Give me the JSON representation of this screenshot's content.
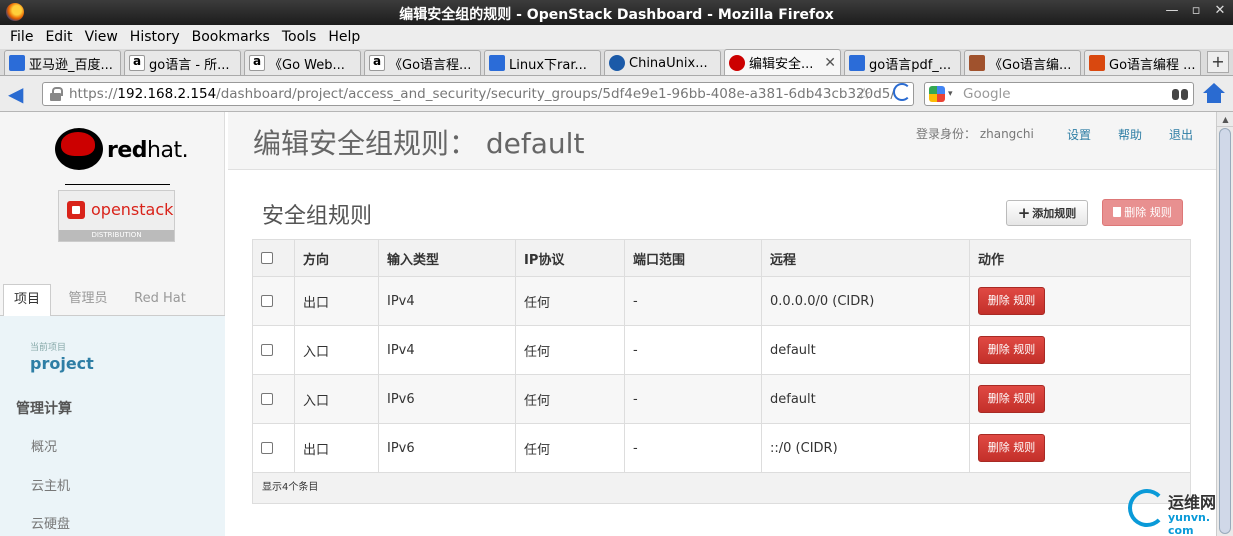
{
  "window": {
    "title": "编辑安全组的规则 - OpenStack Dashboard - Mozilla Firefox",
    "controls": [
      "—",
      "▫",
      "✕"
    ]
  },
  "menu": [
    "File",
    "Edit",
    "View",
    "History",
    "Bookmarks",
    "Tools",
    "Help"
  ],
  "tabs": [
    {
      "label": "亚马逊_百度...",
      "icon": "paw"
    },
    {
      "label": "go语言 - 所...",
      "icon": "amz"
    },
    {
      "label": "《Go Web...",
      "icon": "amz"
    },
    {
      "label": "《Go语言程...",
      "icon": "amz"
    },
    {
      "label": "Linux下rar...",
      "icon": "paw"
    },
    {
      "label": "ChinaUnix...",
      "icon": "cu"
    },
    {
      "label": "编辑安全...",
      "icon": "rh",
      "active": true
    },
    {
      "label": "go语言pdf_...",
      "icon": "paw"
    },
    {
      "label": "《Go语言编...",
      "icon": "book"
    },
    {
      "label": "Go语言编程 ...",
      "icon": "jb"
    }
  ],
  "nav": {
    "url_prefix": "https://",
    "url_host": "192.168.2.154",
    "url_path": "/dashboard/project/access_and_security/security_groups/5df4e9e1-96bb-408e-a381-6db43cb320d5/",
    "search_placeholder": "Google"
  },
  "sidebar": {
    "brand": {
      "red": "red",
      "hat": "hat.",
      "openstack": "openstack",
      "distribution": "DISTRIBUTION"
    },
    "tabs": [
      "项目",
      "管理员",
      "Red Hat"
    ],
    "current_project_label": "当前项目",
    "current_project": "project",
    "section": "管理计算",
    "links": [
      "概况",
      "云主机",
      "云硬盘"
    ]
  },
  "header": {
    "title": "编辑安全组规则： default",
    "user_label": "登录身份： zhangchi",
    "links": [
      "设置",
      "帮助",
      "退出"
    ]
  },
  "section": {
    "title": "安全组规则",
    "add_button": "添加规则",
    "delete_button": "删除 规则",
    "columns": [
      "方向",
      "输入类型",
      "IP协议",
      "端口范围",
      "远程",
      "动作"
    ],
    "rows": [
      [
        "出口",
        "IPv4",
        "任何",
        "-",
        "0.0.0.0/0 (CIDR)",
        "删除 规则"
      ],
      [
        "入口",
        "IPv4",
        "任何",
        "-",
        "default",
        "删除 规则"
      ],
      [
        "入口",
        "IPv6",
        "任何",
        "-",
        "default",
        "删除 规则"
      ],
      [
        "出口",
        "IPv6",
        "任何",
        "-",
        "::/0 (CIDR)",
        "删除 规则"
      ]
    ],
    "footer": "显示4个条目"
  },
  "watermark": {
    "name": "运维网",
    "url": "yunvn. com"
  }
}
